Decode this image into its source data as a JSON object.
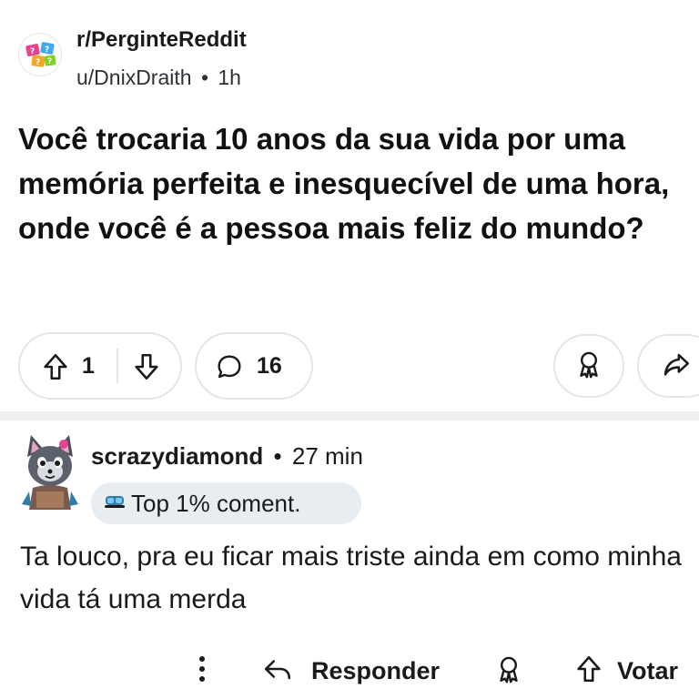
{
  "post": {
    "subreddit": "r/PerginteReddit",
    "author": "u/DnixDraith",
    "separator": "•",
    "time": "1h",
    "title": "Você trocaria 10 anos da sua vida por uma memória perfeita e inesquecível de uma hora, onde você é a pessoa mais feliz do mundo?",
    "votes": "1",
    "comments": "16"
  },
  "comment": {
    "username": "scrazydiamond",
    "separator": "•",
    "time": "27 min",
    "badge": "Top 1% coment.",
    "body": "Ta louco, pra eu ficar mais triste ainda em como minha vida tá uma merda",
    "reply_label": "Responder",
    "vote_label": "Votar"
  },
  "colors": {
    "background": "#efefef",
    "card": "#ffffff",
    "text": "#1a1a1b",
    "muted": "#2d3236",
    "border": "#e3e5e7",
    "badge_bg": "#e8edf2"
  }
}
